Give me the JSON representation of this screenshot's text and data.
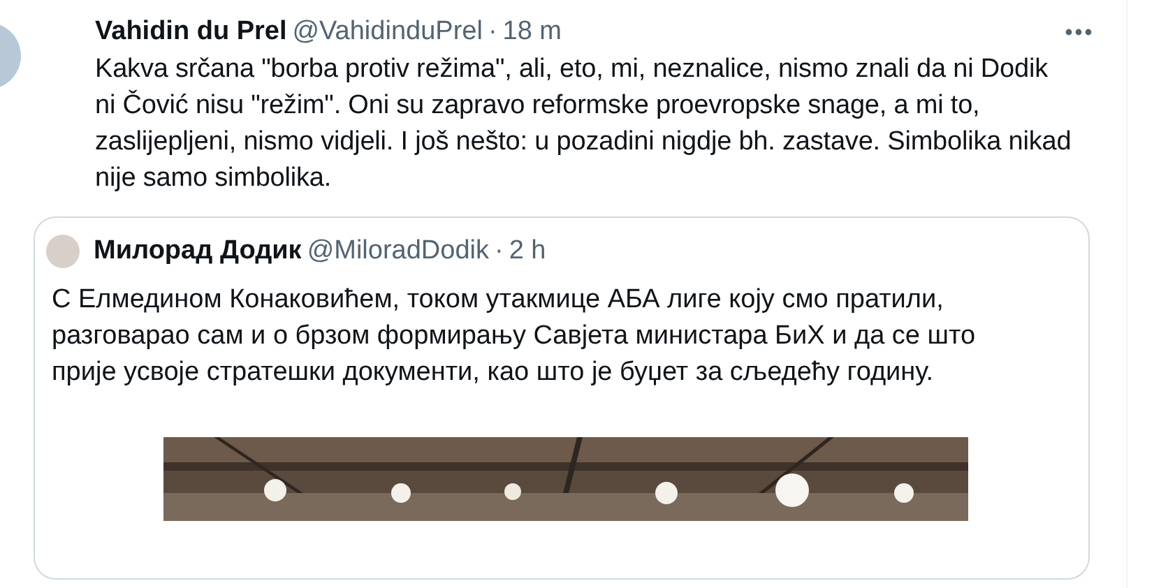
{
  "tweet": {
    "author": "Vahidin du Prel",
    "handle": "@VahidinduPrel",
    "separator": "·",
    "time": "18 m",
    "text": "Kakva srčana \"borba protiv režima\", ali, eto, mi, neznalice, nismo znali da ni Dodik ni Čović nisu \"režim\". Oni su zapravo reformske proevropske snage, a mi to, zaslijepljeni, nismo vidjeli. I još nešto: u pozadini nigdje bh. zastave. Simbolika nikad nije samo simbolika.",
    "quoted": {
      "author": "Милорад Додик",
      "handle": "@MiloradDodik",
      "separator": "·",
      "time": "2 h",
      "text": "С Елмедином Конаковићем, током утакмице АБА лиге коју смо пратили, разговарао сам и о брзом формирању Савјета министара БиХ и да се што прије усвоје стратешки документи, као што је буџет за сљедећу годину."
    }
  }
}
